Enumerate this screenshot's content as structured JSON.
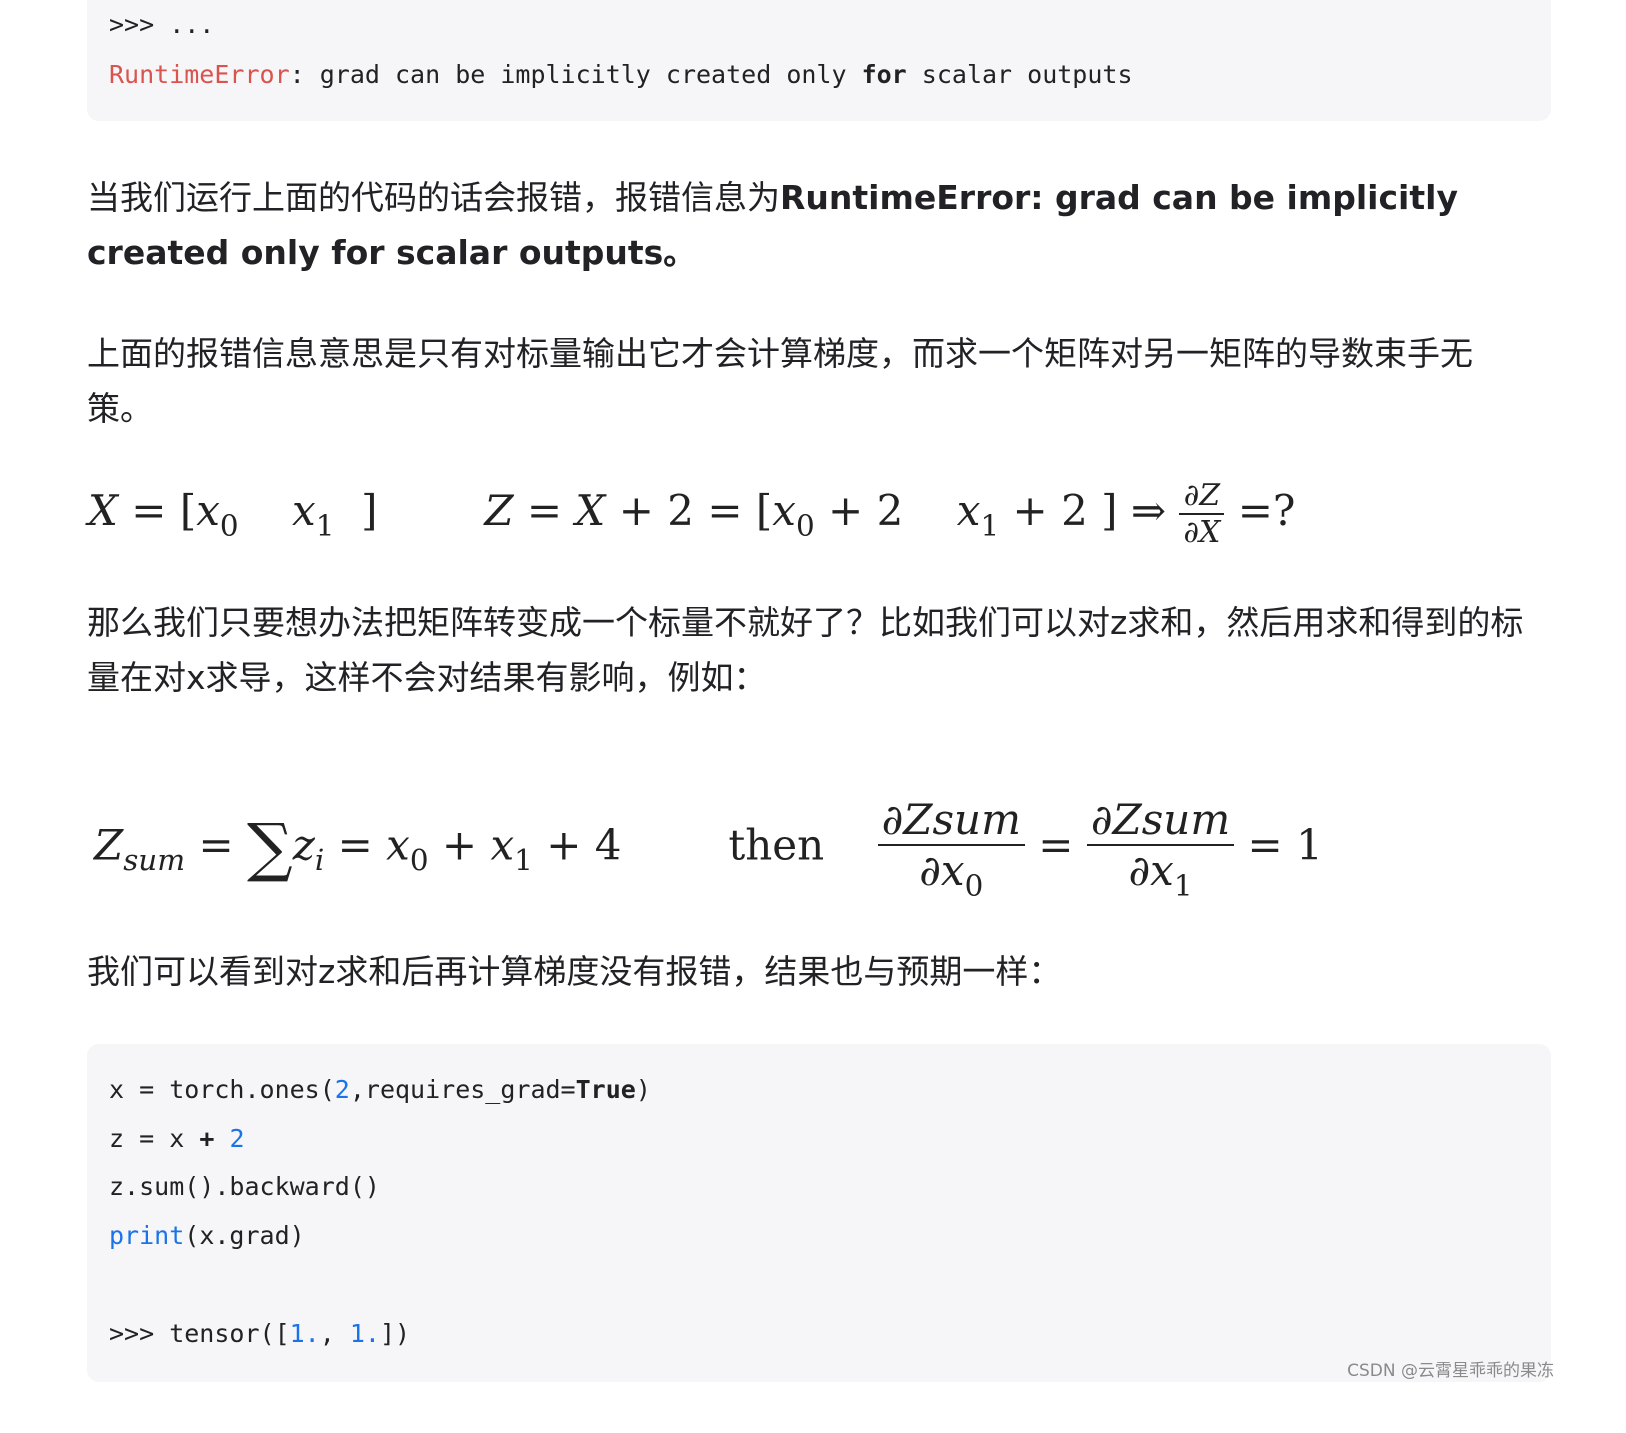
{
  "top_code": {
    "line1": ">>> ...",
    "error_name": "RuntimeError",
    "error_sep": ": grad can be implicitly created only ",
    "error_kw": "for",
    "error_tail": " scalar outputs"
  },
  "paragraphs": {
    "p1_plain": "当我们运行上面的代码的话会报错，报错信息为",
    "p1_bold": "RuntimeError: grad can be implicitly created only for scalar outputs。",
    "p2": "上面的报错信息意思是只有对标量输出它才会计算梯度，而求一个矩阵对另一矩阵的导数束手无策。",
    "p3": "那么我们只要想办法把矩阵转变成一个标量不就好了？比如我们可以对z求和，然后用求和得到的标量在对x求导，这样不会对结果有影响，例如：",
    "p4": "我们可以看到对z求和后再计算梯度没有报错，结果也与预期一样："
  },
  "equation1": {
    "X": "X",
    "eq": "=",
    "lbr": "[",
    "x": "x",
    "s0": "0",
    "s1": "1",
    "rbr": "]",
    "Z": "Z",
    "plus": "+",
    "two": "2",
    "implies": "⇒",
    "partial_num": "∂Z",
    "partial_den": "∂X",
    "result": "=?"
  },
  "equation2": {
    "Z": "Z",
    "sum_sub": "sum",
    "eq": "=",
    "sigma": "∑",
    "z": "z",
    "i": "i",
    "x": "x",
    "s0": "0",
    "s1": "1",
    "plus": "+",
    "four": "4",
    "then": "then",
    "frac_num": "∂Zsum",
    "frac_den_0": "∂x",
    "frac_den_1": "∂x",
    "result": "= 1"
  },
  "bottom_code": {
    "l1_a": "x = torch.ones(",
    "l1_num": "2",
    "l1_b": ",requires_grad=",
    "l1_kw": "True",
    "l1_c": ")",
    "l2_a": "z = x ",
    "l2_op": "+",
    "l2_sp": " ",
    "l2_num": "2",
    "l3": "z.sum().backward()",
    "l4_fn": "print",
    "l4_rest": "(x.grad)",
    "l5_a": ">>> tensor([",
    "l5_n1": "1.",
    "l5_b": ", ",
    "l5_n2": "1.",
    "l5_c": "])"
  },
  "watermark": "CSDN @云霄星乖乖的果冻"
}
